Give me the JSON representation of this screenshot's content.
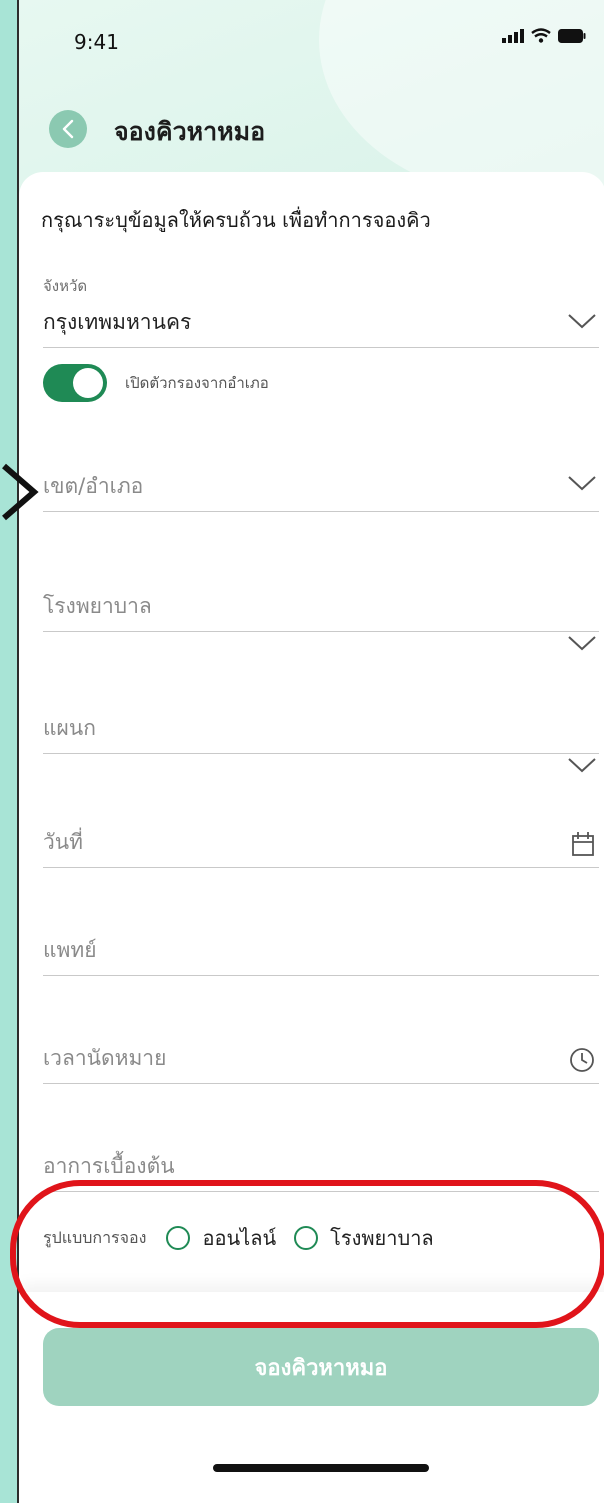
{
  "status": {
    "time": "9:41"
  },
  "header": {
    "title": "จองคิวหาหมอ"
  },
  "form": {
    "instruction": "กรุณาระบุข้อมูลให้ครบถ้วน เพื่อทำการจองคิว",
    "province": {
      "label": "จังหวัด",
      "value": "กรุงเทพมหานคร"
    },
    "filter_toggle": {
      "label": "เปิดตัวกรองจากอำเภอ",
      "on": true
    },
    "district": {
      "placeholder": "เขต/อำเภอ"
    },
    "hospital": {
      "placeholder": "โรงพยาบาล"
    },
    "department": {
      "placeholder": "แผนก"
    },
    "date": {
      "placeholder": "วันที่"
    },
    "doctor": {
      "placeholder": "แพทย์"
    },
    "appointment_time": {
      "placeholder": "เวลานัดหมาย"
    },
    "symptoms": {
      "placeholder": "อาการเบื้องต้น"
    },
    "booking_type": {
      "label": "รูปแบบการจอง",
      "options": [
        "ออนไลน์",
        "โรงพยาบาล"
      ]
    }
  },
  "submit": {
    "label": "จองคิวหาหมอ"
  },
  "colors": {
    "accent": "#1f8a55",
    "button": "#9fd3bf",
    "background": "#a8e4d6",
    "annotation": "#e0141a"
  },
  "icons": [
    "back-icon",
    "signal-icon",
    "wifi-icon",
    "battery-icon",
    "chevron-down-icon",
    "calendar-icon",
    "clock-icon"
  ]
}
